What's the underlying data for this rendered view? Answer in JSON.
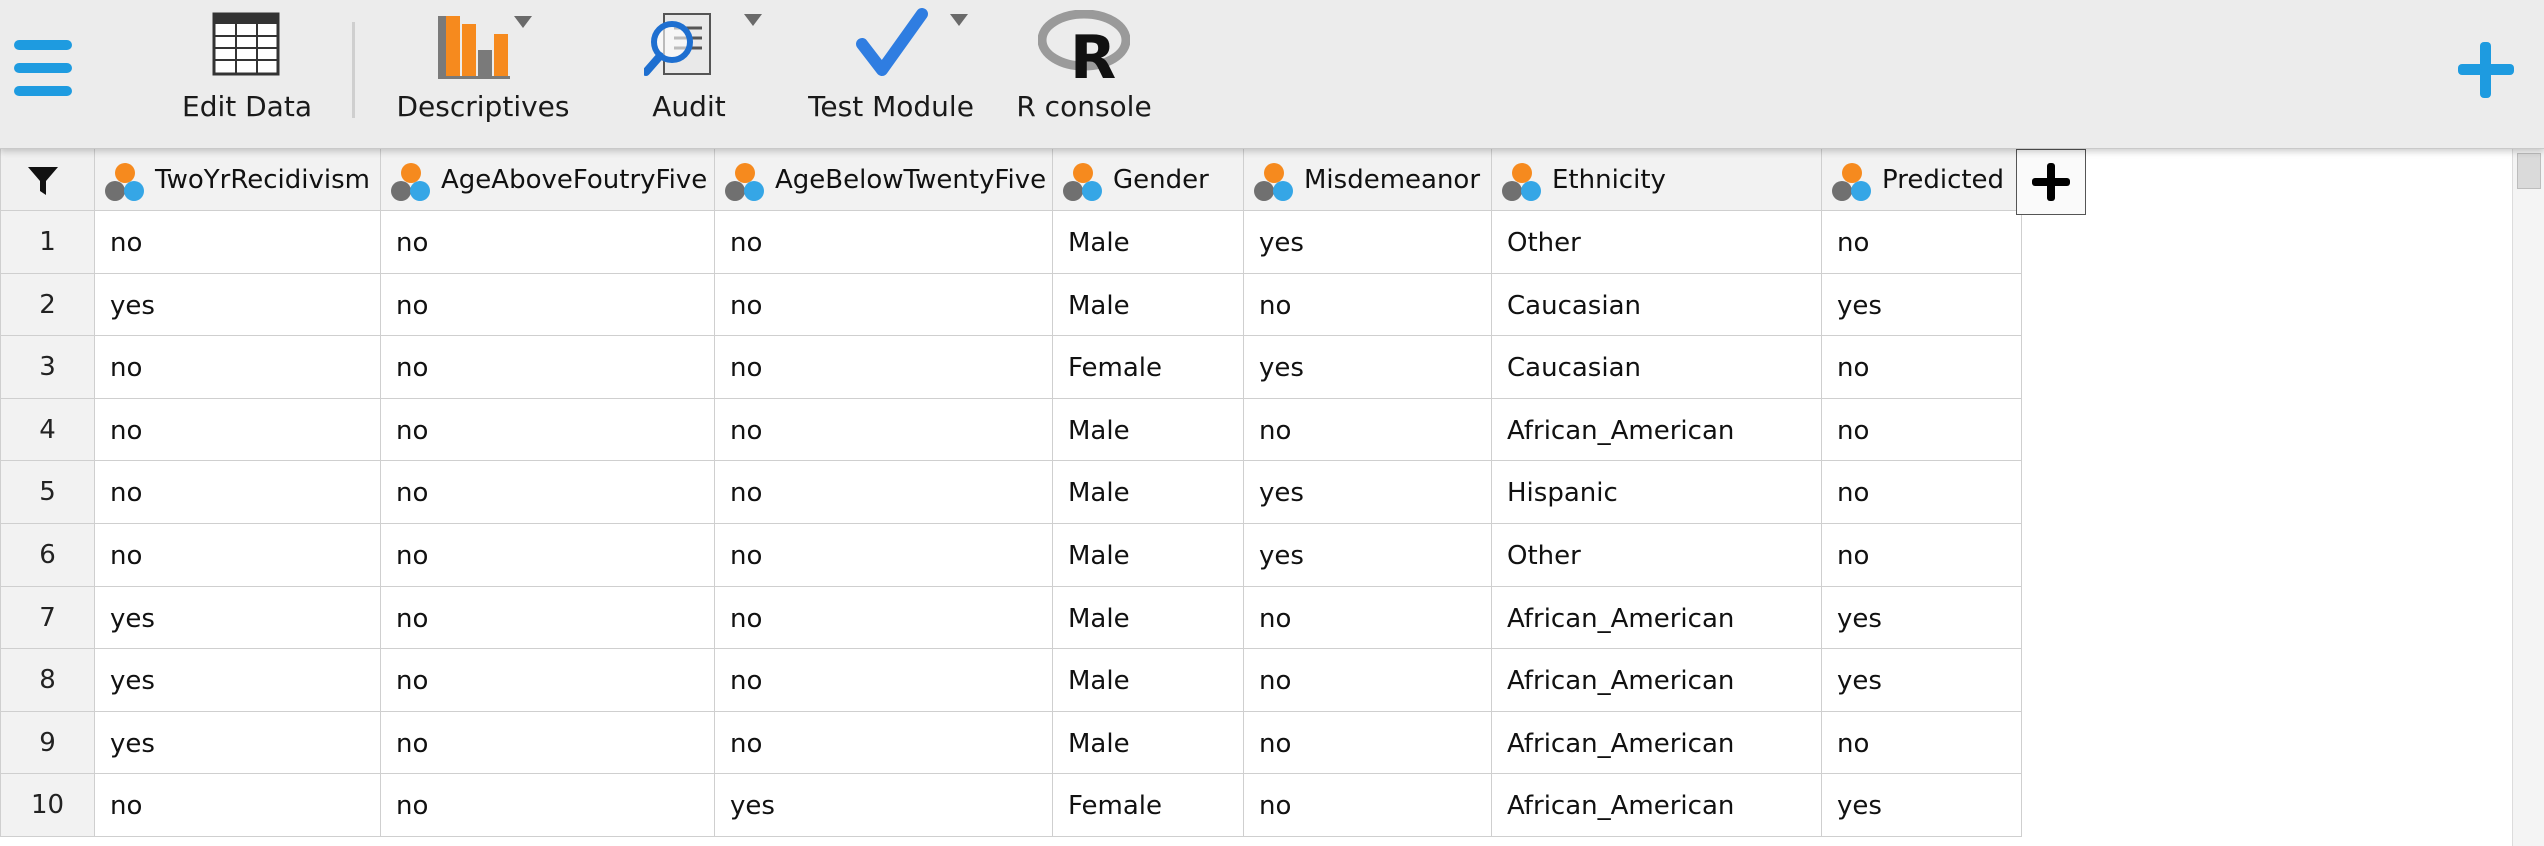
{
  "toolbar": {
    "buttons": [
      {
        "label": "Edit Data",
        "icon": "table-icon"
      },
      {
        "label": "Descriptives",
        "icon": "bar-chart-icon",
        "has_dropdown": true
      },
      {
        "label": "Audit",
        "icon": "magnifier-report-icon",
        "has_dropdown": true
      },
      {
        "label": "Test Module",
        "icon": "checkmark-icon",
        "has_dropdown": true
      },
      {
        "label": "R console",
        "icon": "r-logo-icon"
      }
    ],
    "colors": {
      "accent": "#1e9be0",
      "bar_orange": "#f68a1e",
      "bar_gray": "#7a7a7a"
    }
  },
  "table": {
    "columns": [
      "TwoYrRecidivism",
      "AgeAboveFoutryFive",
      "AgeBelowTwentyFive",
      "Gender",
      "Misdemeanor",
      "Ethnicity",
      "Predicted"
    ],
    "rows": [
      {
        "num": "1",
        "cells": [
          "no",
          "no",
          "no",
          "Male",
          "yes",
          "Other",
          "no"
        ]
      },
      {
        "num": "2",
        "cells": [
          "yes",
          "no",
          "no",
          "Male",
          "no",
          "Caucasian",
          "yes"
        ]
      },
      {
        "num": "3",
        "cells": [
          "no",
          "no",
          "no",
          "Female",
          "yes",
          "Caucasian",
          "no"
        ]
      },
      {
        "num": "4",
        "cells": [
          "no",
          "no",
          "no",
          "Male",
          "no",
          "African_American",
          "no"
        ]
      },
      {
        "num": "5",
        "cells": [
          "no",
          "no",
          "no",
          "Male",
          "yes",
          "Hispanic",
          "no"
        ]
      },
      {
        "num": "6",
        "cells": [
          "no",
          "no",
          "no",
          "Male",
          "yes",
          "Other",
          "no"
        ]
      },
      {
        "num": "7",
        "cells": [
          "yes",
          "no",
          "no",
          "Male",
          "no",
          "African_American",
          "yes"
        ]
      },
      {
        "num": "8",
        "cells": [
          "yes",
          "no",
          "no",
          "Male",
          "no",
          "African_American",
          "yes"
        ]
      },
      {
        "num": "9",
        "cells": [
          "yes",
          "no",
          "no",
          "Male",
          "no",
          "African_American",
          "no"
        ]
      },
      {
        "num": "10",
        "cells": [
          "no",
          "no",
          "yes",
          "Female",
          "no",
          "African_American",
          "yes"
        ]
      }
    ],
    "column_type_icon": "nominal-variable-icon"
  }
}
